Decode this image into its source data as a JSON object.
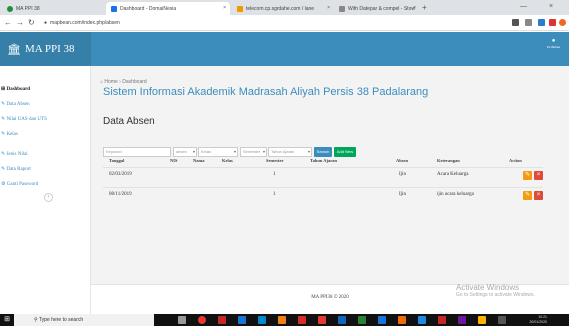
{
  "browser": {
    "tabs": [
      {
        "label": "MA PPI 38",
        "favicon": "#1e8f3b",
        "active": false
      },
      {
        "label": "Dashboard - DomaiNesia",
        "favicon": "#1a73e8",
        "active": true
      },
      {
        "label": "telecom.cp.sgrdahe.com / lane",
        "favicon": "#f29900",
        "active": false
      },
      {
        "label": "With Datepar & compel - Stow",
        "favicon": "#888888",
        "active": false
      }
    ],
    "url": "mapbean.com/index.php/absen",
    "new_tab": "+",
    "win_min": "—",
    "win_close": "×"
  },
  "app": {
    "brand": "MA PPI 38",
    "user": "Pe Bebas",
    "accent": "#3c8dbc"
  },
  "sidebar": {
    "items": [
      {
        "label": "Dashboard",
        "icon": "dashboard-icon"
      },
      {
        "label": "Data Absen",
        "icon": "edit-icon"
      },
      {
        "label": "Nilai UAS dan UTS",
        "icon": "edit-icon"
      },
      {
        "label": "Kelas",
        "icon": "edit-icon"
      },
      {
        "label": "Jenis Nilai",
        "icon": "edit-icon"
      },
      {
        "label": "Data Raport",
        "icon": "edit-icon"
      },
      {
        "label": "Ganti Password",
        "icon": "settings-icon"
      }
    ],
    "toggle": "‹"
  },
  "breadcrumb": {
    "home": "Home",
    "current": "Dashboard"
  },
  "main": {
    "page_title": "Sistem Informasi Akademik Madrasah Aliyah Persis 38 Padalarang",
    "section_title": "Data Absen"
  },
  "filters": {
    "keyword_placeholder": "Keyword",
    "absen": "absen",
    "kelas": "Kelas",
    "semester": "Semester",
    "tahun": "Tahun Ajaran",
    "search": "Search",
    "add": "Add New"
  },
  "table": {
    "headers": [
      "Tanggal",
      "NIS",
      "Nama",
      "Kelas",
      "Semester",
      "Tahun Ajaran",
      "Absen",
      "Keterangan",
      "Action"
    ],
    "rows": [
      {
        "tanggal": "02/03/2019",
        "nis": "",
        "nama": "",
        "kelas": "",
        "semester": "1",
        "tahun": "",
        "absen": "Ijin",
        "keterangan": "Acara Keluarga"
      },
      {
        "tanggal": "08/11/2019",
        "nis": "",
        "nama": "",
        "kelas": "",
        "semester": "1",
        "tahun": "",
        "absen": "Ijin",
        "keterangan": "ijin acara keluarga"
      }
    ]
  },
  "footer": {
    "text": "MA PPI38 © 2020"
  },
  "watermark": {
    "line1": "Activate Windows",
    "line2": "Go to Settings to activate Windows."
  },
  "taskbar": {
    "search": "Type here to search",
    "time": "10:21",
    "date": "20/01/2020"
  }
}
